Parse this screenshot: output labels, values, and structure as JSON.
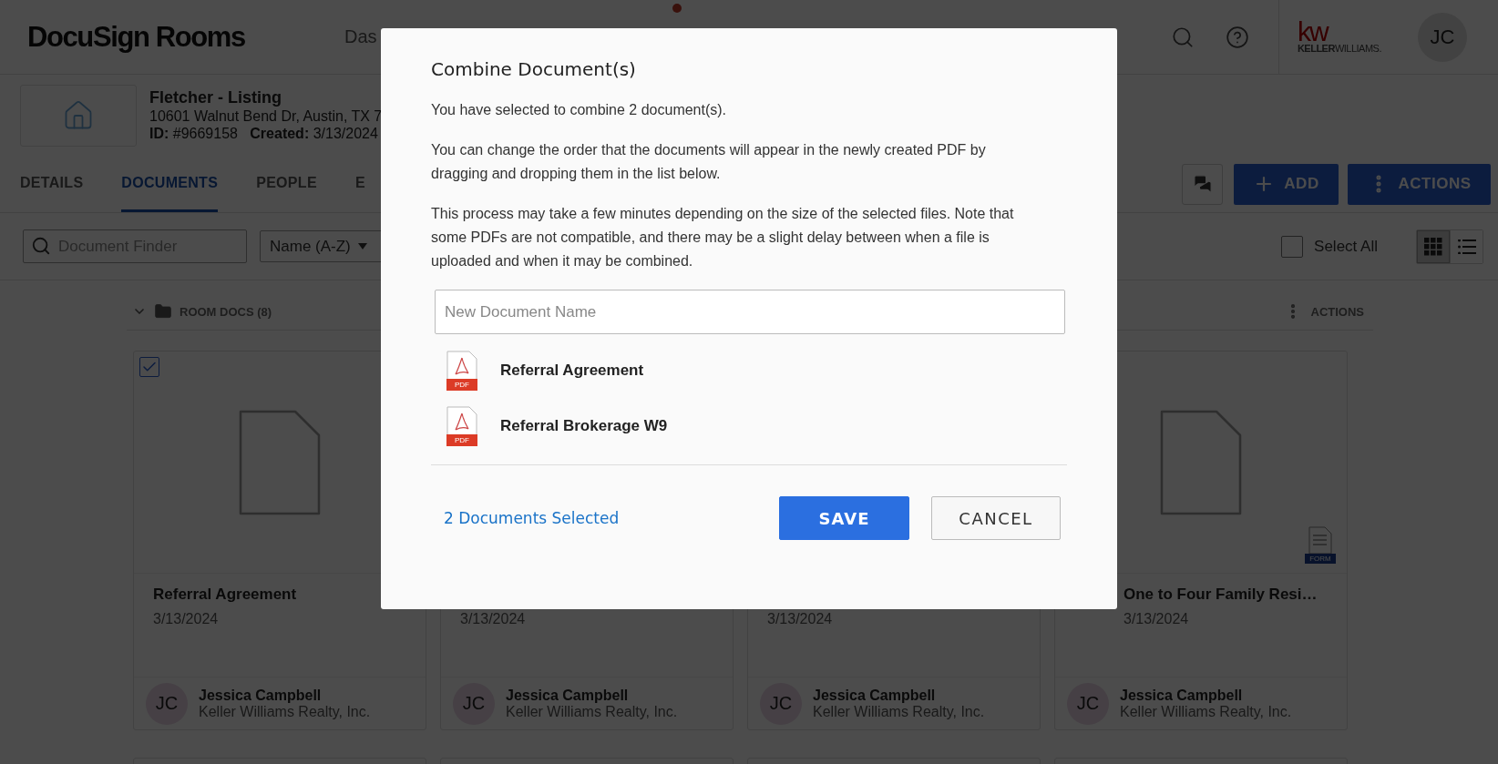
{
  "header": {
    "logo": "DocuSign Rooms",
    "nav": [
      "Das"
    ],
    "brand": {
      "mark": "kw",
      "name_bold": "KELLER",
      "name_light": "WILLIAMS."
    },
    "avatar": "JC"
  },
  "room": {
    "title": "Fletcher - Listing",
    "address": "10601 Walnut Bend Dr, Austin, TX 7",
    "meta": "**ID:** #9669158   **Created:** 3/13/2024"
  },
  "tabs": [
    {
      "label": "DETAILS",
      "selected": false
    },
    {
      "label": "DOCUMENTS",
      "selected": true
    },
    {
      "label": "PEOPLE",
      "selected": false
    },
    {
      "label": "E",
      "selected": false
    }
  ],
  "toolbar": {
    "add": "ADD",
    "actions": "ACTIONS",
    "finder": {
      "placeholder": "Document Finder"
    },
    "sort": "Name (A-Z)",
    "select_all": {
      "label": "Select All",
      "checked": false
    },
    "views": [
      {
        "kind": "grid",
        "selected": true
      },
      {
        "kind": "list",
        "selected": false
      }
    ]
  },
  "section": {
    "title": "ROOM DOCS (8)",
    "expanded": true,
    "actions": "ACTIONS"
  },
  "cards": [
    {
      "kind": "file",
      "title": "Referral Agreement",
      "date": "3/13/2024",
      "checked": true,
      "initials": "JC",
      "owner": "Jessica Campbell",
      "company": "Keller Williams Realty, Inc."
    },
    {
      "kind": "file",
      "date": "3/13/2024",
      "checked": false,
      "initials": "JC",
      "owner": "Jessica Campbell",
      "company": "Keller Williams Realty, Inc."
    },
    {
      "kind": "file",
      "date": "3/13/2024",
      "checked": false,
      "initials": "JC",
      "owner": "Jessica Campbell",
      "company": "Keller Williams Realty, Inc."
    },
    {
      "kind": "form",
      "badge": "FORM",
      "title": "One to Four Family Resi…",
      "date": "3/13/2024",
      "checked": false,
      "initials": "JC",
      "owner": "Jessica Campbell",
      "company": "Keller Williams Realty, Inc."
    }
  ],
  "dialog": {
    "title": "Combine Document(s)",
    "paragraphs": [
      "You have selected to combine 2 document(s).",
      "You can change the order that the documents will appear in the newly created PDF by dragging and dropping them in the list below.",
      "This process may take a few minutes depending on the size of the selected files. Note that some PDFs are not compatible, and there may be a slight delay between when a file is uploaded and when it may be combined."
    ],
    "name_field": {
      "placeholder": "New Document Name"
    },
    "documents": [
      {
        "name": "Referral Agreement",
        "badge": "PDF"
      },
      {
        "name": "Referral Brokerage W9",
        "badge": "PDF"
      }
    ],
    "selected_count": "2 Documents Selected",
    "save": "SAVE",
    "cancel": "CANCEL"
  }
}
